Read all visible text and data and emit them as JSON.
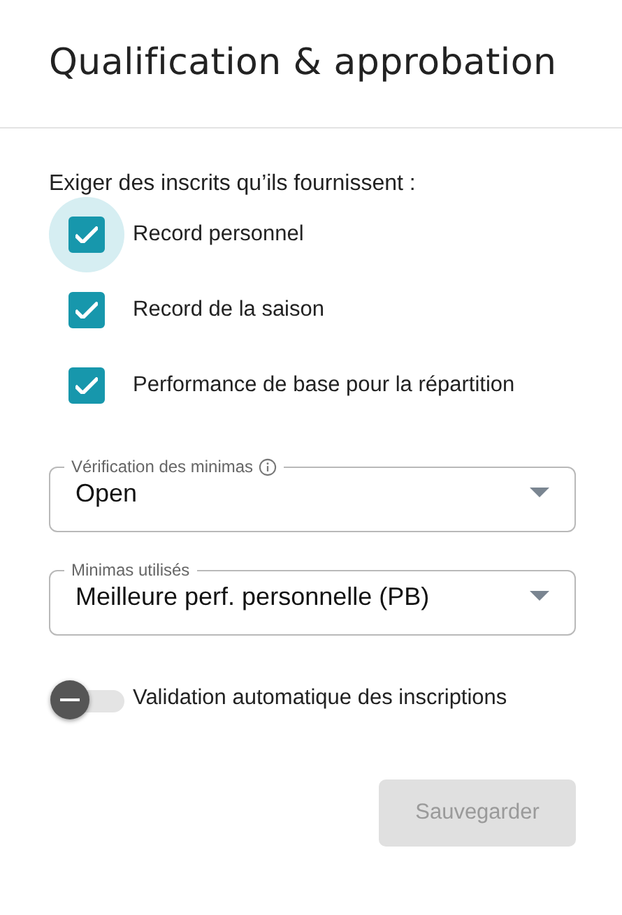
{
  "dialog": {
    "title": "Qualification & approbation"
  },
  "requirements": {
    "prompt": "Exiger des inscrits qu’ils fournissent :",
    "options": [
      {
        "label": "Record personnel",
        "checked": true,
        "focused": true
      },
      {
        "label": "Record de la saison",
        "checked": true,
        "focused": false
      },
      {
        "label": "Performance de base pour la répartition",
        "checked": true,
        "focused": false
      }
    ]
  },
  "selects": [
    {
      "label": "Vérification des minimas",
      "info": true,
      "value": "Open"
    },
    {
      "label": "Minimas utilisés",
      "info": false,
      "value": "Meilleure perf. personnelle (PB)"
    }
  ],
  "auto_validation": {
    "label": "Validation automatique des inscriptions",
    "on": false
  },
  "save_button": {
    "label": "Sauvegarder",
    "disabled": true
  }
}
